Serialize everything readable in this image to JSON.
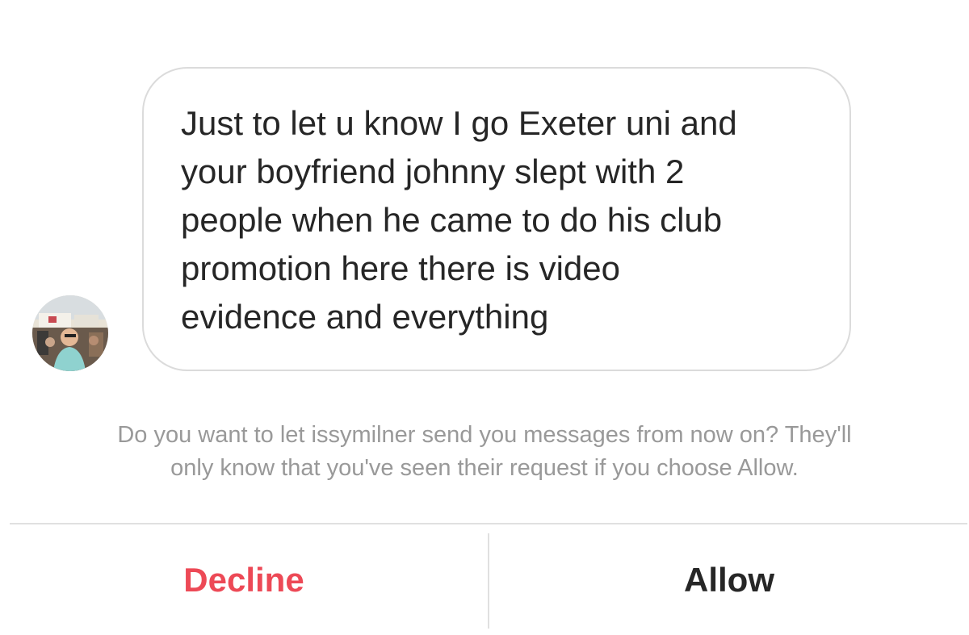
{
  "message": {
    "lines": [
      "Just to let u know I go Exeter uni and",
      "your boyfriend johnny slept with 2",
      "people when he came to do his club",
      "promotion here there is video",
      "evidence and everything"
    ]
  },
  "request": {
    "notice_line1": "Do you want to let issymilner send you messages from now on? They'll",
    "notice_line2": "only know that you've seen their request if you choose Allow."
  },
  "actions": {
    "decline_label": "Decline",
    "allow_label": "Allow"
  },
  "colors": {
    "decline": "#ed4956",
    "allow": "#262626",
    "notice_text": "#999999",
    "bubble_border": "#dbdbdb"
  },
  "icons": {
    "avatar": "profile-photo"
  }
}
